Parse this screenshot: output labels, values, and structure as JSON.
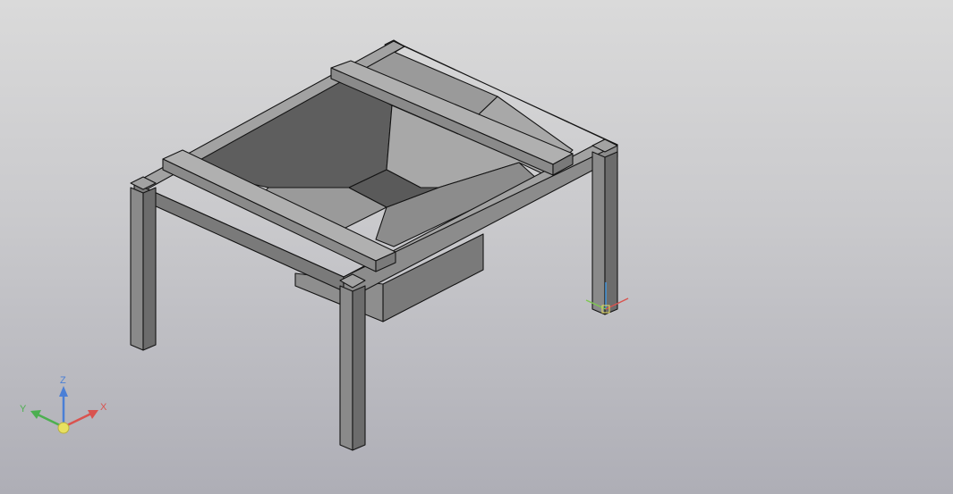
{
  "viewport": {
    "background_top": "#dadada",
    "background_bottom": "#aeaeb6"
  },
  "model": {
    "edge_color": "#141414",
    "face_colors": {
      "leg_front": "#8a8a8a",
      "leg_side": "#6c6c6c",
      "frame_top": "#9c9c9c",
      "frame_side": "#7a7a7a",
      "hopper_dark": "#5e5e5e",
      "hopper_mid": "#8c8c8c",
      "hopper_light": "#a8a8a8",
      "box_front": "#7a7a7a",
      "box_side": "#8e8e8e"
    }
  },
  "triad": {
    "x_label": "X",
    "y_label": "Y",
    "z_label": "Z",
    "x_color": "#d9534f",
    "y_color": "#4caf50",
    "z_color": "#4a7fd6",
    "origin_color": "#e8e060"
  },
  "ucs_icon": {
    "x_color": "#d9534f",
    "y_color": "#7ec850",
    "z_color": "#4a9be0"
  }
}
